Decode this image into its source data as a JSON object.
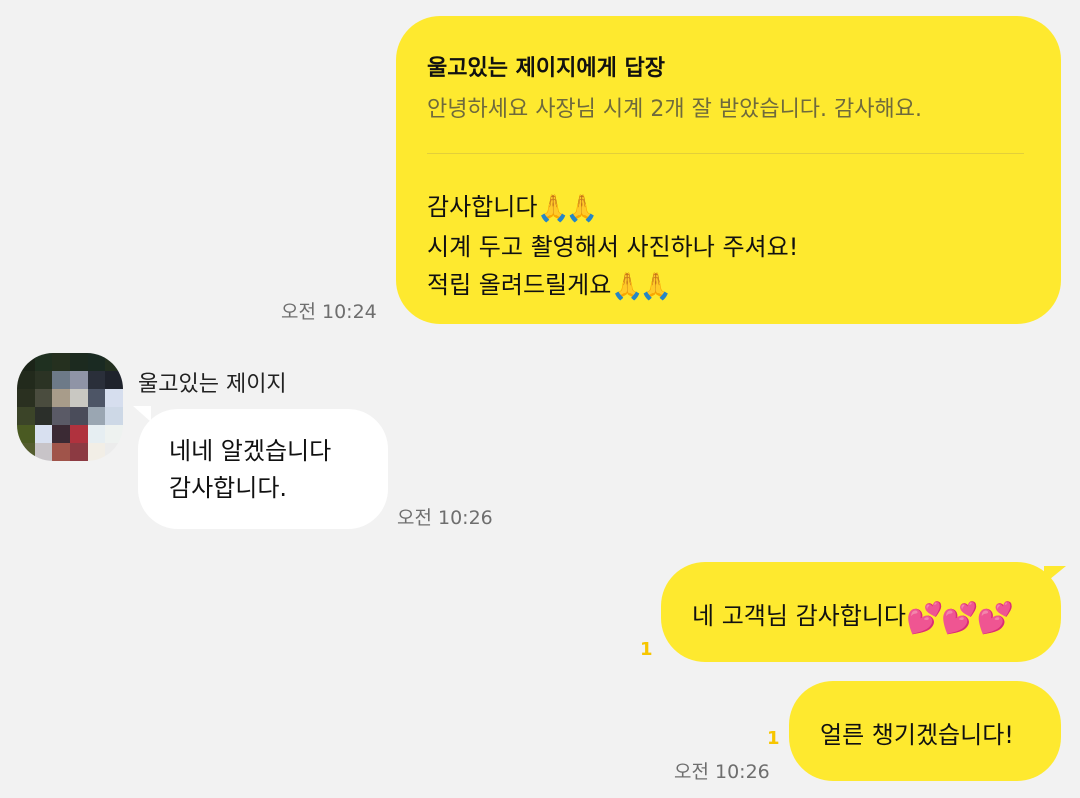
{
  "colors": {
    "background": "#f2f2f2",
    "my_bubble": "#fee92f",
    "other_bubble": "#ffffff",
    "unread_count": "#f7c600",
    "timestamp": "#6e6e6e"
  },
  "messages": [
    {
      "from": "me",
      "type": "reply",
      "reply_title": "울고있는 제이지에게 답장",
      "reply_quote": "안녕하세요 사장님 시계 2개 잘 받았습니다. 감사해요.",
      "lines": [
        "감사합니다",
        "시계 두고 촬영해서 사진하나 주셔요!",
        "적립 올려드릴게요"
      ],
      "emoji": "🙏🙏",
      "time": "오전 10:24"
    },
    {
      "from": "other",
      "sender": "울고있는 제이지",
      "lines": [
        "네네 알겠습니다",
        "감사합니다."
      ],
      "time": "오전 10:26"
    },
    {
      "from": "me",
      "text": "네 고객님 감사합니다",
      "emoji": "💕💕💕",
      "unread": "1"
    },
    {
      "from": "me",
      "text": "얼른 챙기겠습니다!",
      "unread": "1",
      "time": "오전 10:26"
    }
  ]
}
